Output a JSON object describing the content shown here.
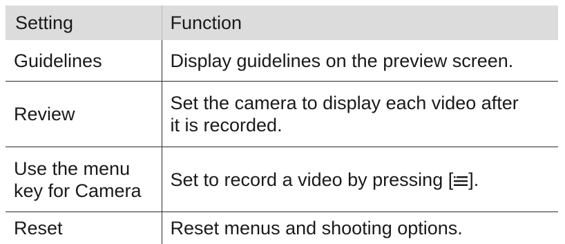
{
  "table": {
    "header": {
      "setting": "Setting",
      "function": "Function"
    },
    "rows": [
      {
        "setting": "Guidelines",
        "function": "Display guidelines on the preview screen."
      },
      {
        "setting": "Review",
        "function_line1": "Set the camera to display each video after",
        "function_line2": "it is recorded."
      },
      {
        "setting_line1": "Use the menu",
        "setting_line2": "key for Camera",
        "function_before": "Set to record a video by pressing [",
        "function_icon": "menu-key-icon",
        "function_after": "]."
      },
      {
        "setting": "Reset",
        "function": "Reset menus and shooting options."
      }
    ]
  }
}
